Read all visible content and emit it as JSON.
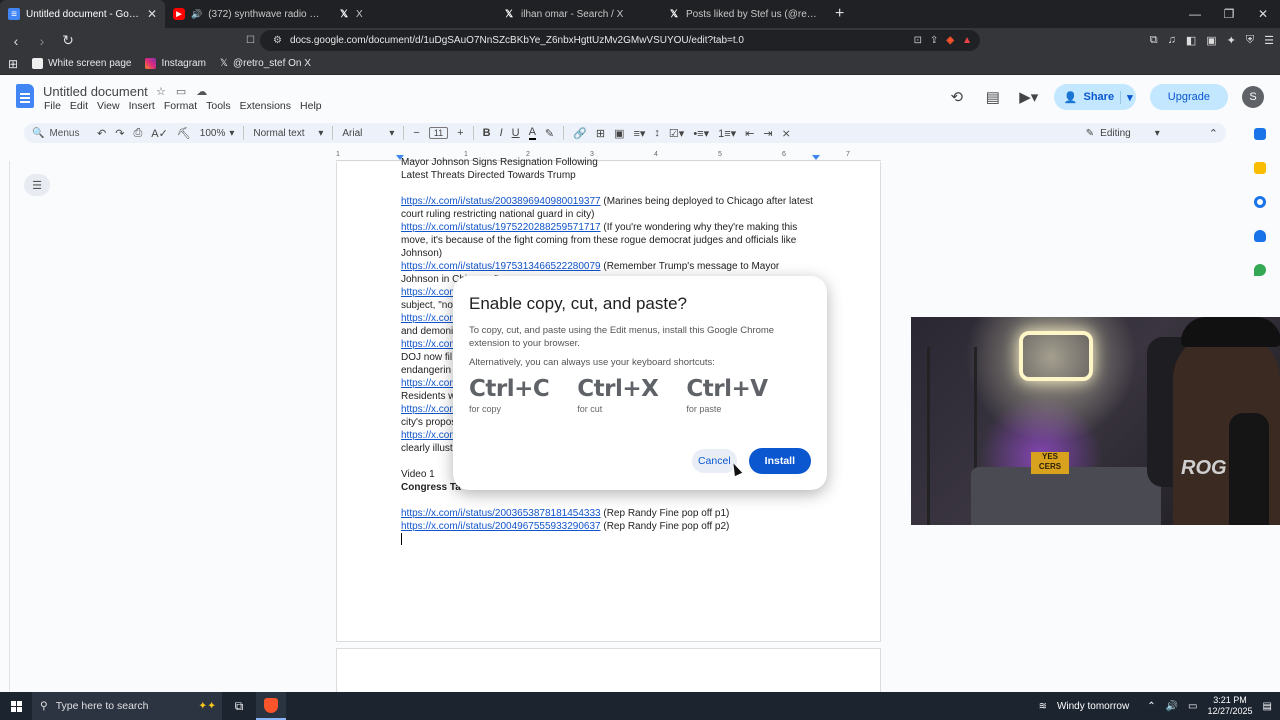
{
  "browser": {
    "tabs": [
      {
        "title": "Untitled document - Google Do",
        "icon": "docs",
        "active": true
      },
      {
        "title": "(372) synthwave radio 🌌 beats",
        "icon": "youtube",
        "active": false
      },
      {
        "title": "X",
        "icon": "x",
        "active": false
      },
      {
        "title": "ilhan omar - Search / X",
        "icon": "x",
        "active": false
      },
      {
        "title": "Posts liked by Stef us (@retro_stef) /",
        "icon": "x",
        "active": false
      }
    ],
    "new_tab": "+",
    "url": "docs.google.com/document/d/1uDgSAuO7NnSZcBKbYe_Z6nbxHgttUzMv2GMwVSUYOU/edit?tab=t.0",
    "bookmarks": [
      "White screen page",
      "Instagram",
      "@retro_stef On X"
    ]
  },
  "docs": {
    "title": "Untitled document",
    "menu": [
      "File",
      "Edit",
      "View",
      "Insert",
      "Format",
      "Tools",
      "Extensions",
      "Help"
    ],
    "share_label": "Share",
    "upgrade_label": "Upgrade",
    "avatar_letter": "S",
    "toolbar": {
      "search": "Menus",
      "zoom": "100%",
      "style": "Normal text",
      "font": "Arial",
      "font_size": "11",
      "mode": "Editing"
    },
    "ruler_ticks": [
      "1",
      "1",
      "2",
      "3",
      "4",
      "5",
      "6",
      "7"
    ],
    "content": [
      {
        "type": "text",
        "text": "Mayor Johnson Signs Resignation Following"
      },
      {
        "type": "text",
        "text": "Latest Threats Directed Towards Trump"
      },
      {
        "type": "blank"
      },
      {
        "type": "link",
        "link": "https://x.com/i/status/2003896940980019377",
        "text": " (Marines being deployed to Chicago after latest court ruling restricting national guard in city)"
      },
      {
        "type": "link",
        "link": "https://x.com/i/status/1975220288259571717",
        "text": " (If you're wondering why they're making this move, it's because of the fight coming from these rogue democrat judges and officials like Johnson)"
      },
      {
        "type": "link",
        "link": "https://x.com/i/status/1975313466522280079",
        "text": " (Remember Trump's message to Mayor Johnson in Chicago, \""
      },
      {
        "type": "partial",
        "link": "https://x.com/",
        "text": "subject, \"no"
      },
      {
        "type": "partial",
        "link": "https://x.com",
        "text": ""
      },
      {
        "type": "text",
        "text": "and demoni"
      },
      {
        "type": "partial",
        "link": "https://x.com",
        "text": ""
      },
      {
        "type": "text",
        "text": "DOJ now fil"
      },
      {
        "type": "text",
        "text": "endangerin"
      },
      {
        "type": "partial",
        "link": "https://x.com",
        "text": ""
      },
      {
        "type": "text",
        "text": "Residents w"
      },
      {
        "type": "partial",
        "link": "https://x.com",
        "text": ""
      },
      {
        "type": "text",
        "text": "city's propos"
      },
      {
        "type": "partial",
        "link": "https://x.com",
        "text": ""
      },
      {
        "type": "text",
        "text": "clearly illust"
      },
      {
        "type": "blank"
      },
      {
        "type": "text",
        "text": "Video 1"
      },
      {
        "type": "bold",
        "text": "Congress Ta"
      },
      {
        "type": "blank"
      },
      {
        "type": "link",
        "link": "https://x.com/i/status/2003653878181454333",
        "text": " (Rep Randy Fine pop off p1)"
      },
      {
        "type": "link",
        "link": "https://x.com/i/status/2004967555933290637",
        "text": " (Rep Randy Fine pop off p2)"
      }
    ]
  },
  "dialog": {
    "title": "Enable copy, cut, and paste?",
    "body": "To copy, cut, and paste using the Edit menus, install this Google Chrome extension to your browser.",
    "alt": "Alternatively, you can always use your keyboard shortcuts:",
    "shortcuts": [
      {
        "key": "Ctrl+C",
        "label": "for copy"
      },
      {
        "key": "Ctrl+X",
        "label": "for cut"
      },
      {
        "key": "Ctrl+V",
        "label": "for paste"
      }
    ],
    "cancel_label": "Cancel",
    "install_label": "Install"
  },
  "webcam": {
    "sign_text": "YES CERS",
    "chair_text": "ROG"
  },
  "taskbar": {
    "search_placeholder": "Type here to search",
    "weather": "Windy tomorrow",
    "time": "3:21 PM",
    "date": "12/27/2025"
  }
}
